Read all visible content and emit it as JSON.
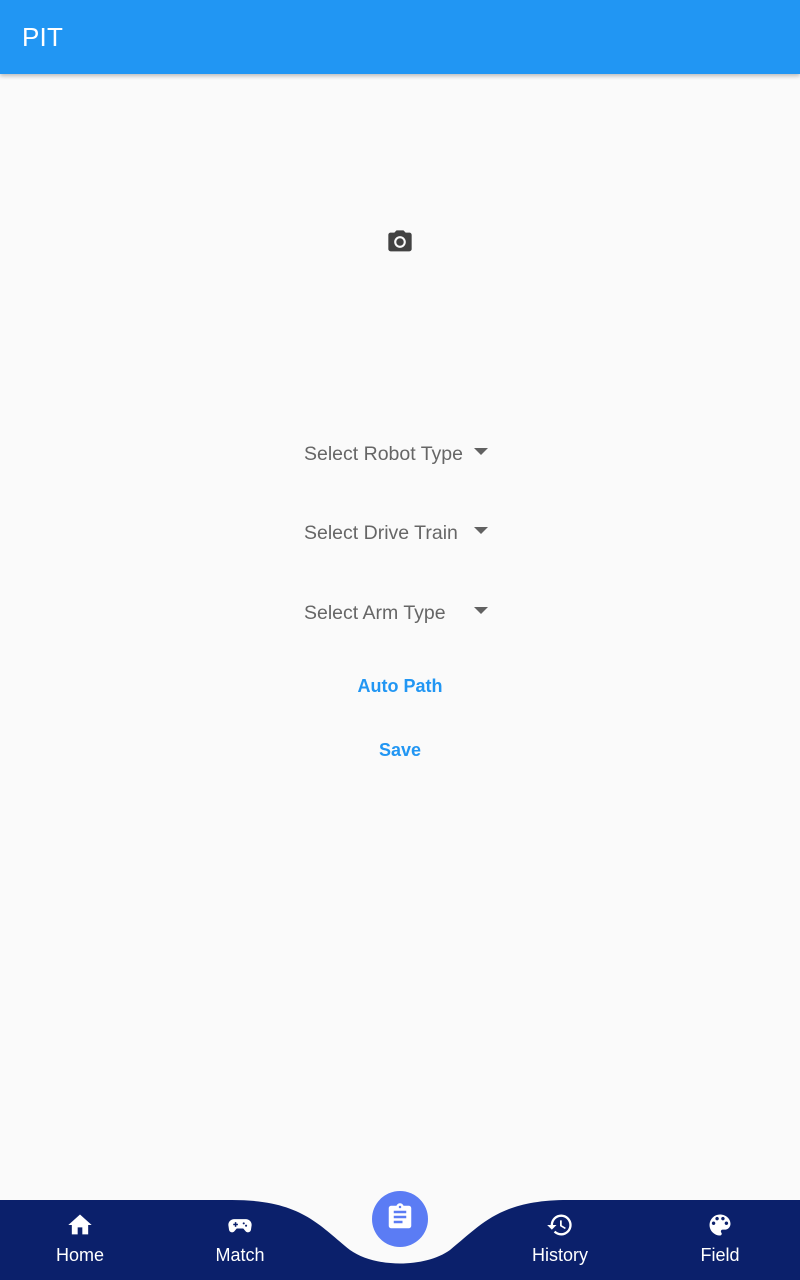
{
  "app_bar": {
    "title": "PIT"
  },
  "photo": {
    "icon": "camera-icon"
  },
  "form": {
    "robot_type": {
      "placeholder": "Select Robot Type",
      "icon": "arrow-drop-down-icon"
    },
    "drive_train": {
      "placeholder": "Select Drive Train",
      "icon": "arrow-drop-down-icon"
    },
    "arm_type": {
      "placeholder": "Select Arm Type",
      "icon": "arrow-drop-down-icon"
    }
  },
  "actions": {
    "auto_path_label": "Auto Path",
    "save_label": "Save"
  },
  "bottom_nav": {
    "items": [
      {
        "label": "Home",
        "icon": "home-icon"
      },
      {
        "label": "Match",
        "icon": "gamepad-icon"
      },
      {
        "label": "History",
        "icon": "history-icon"
      },
      {
        "label": "Field",
        "icon": "palette-icon"
      }
    ],
    "center": {
      "icon": "assignment-icon",
      "selected": true
    }
  },
  "colors": {
    "app_bar": "#2196f3",
    "background": "#fafafa",
    "bottom_nav": "#0b206b",
    "fab": "#5b7cf4",
    "accent_text": "#2196f3",
    "hint_text": "#666666"
  }
}
